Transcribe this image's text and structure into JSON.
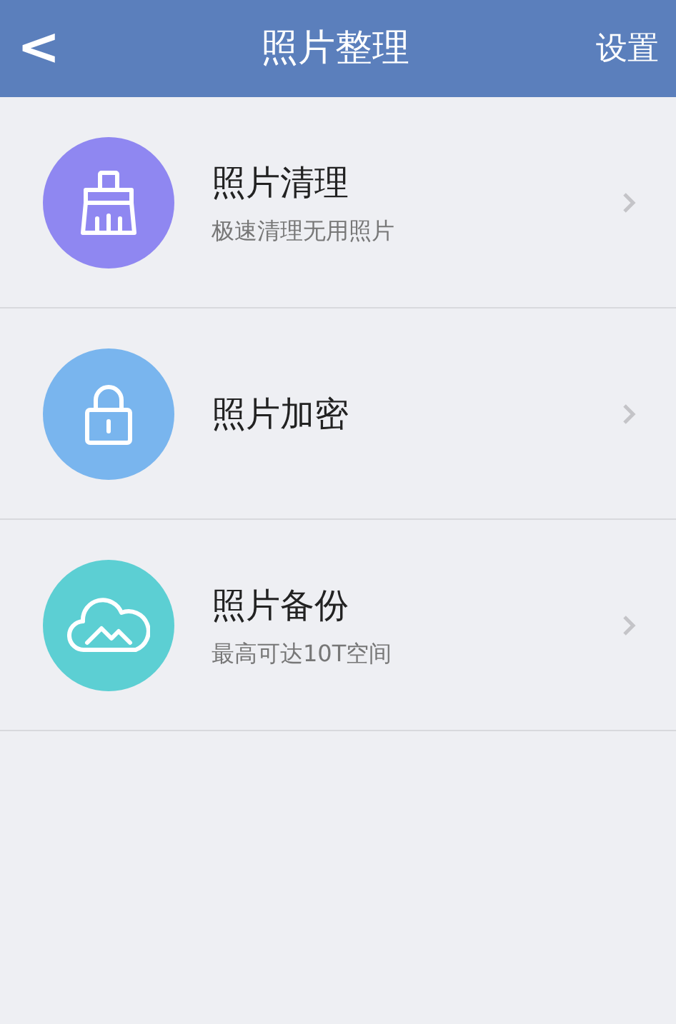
{
  "header": {
    "back": "<",
    "title": "照片整理",
    "action": "设置"
  },
  "items": [
    {
      "kind": "broom",
      "color": "#8f87f1",
      "title": "照片清理",
      "subtitle": "极速清理无用照片"
    },
    {
      "kind": "lock",
      "color": "#79b5ee",
      "title": "照片加密"
    },
    {
      "kind": "cloud",
      "color": "#5ccfd3",
      "title": "照片备份",
      "subtitle": "最高可达10T空间"
    }
  ]
}
